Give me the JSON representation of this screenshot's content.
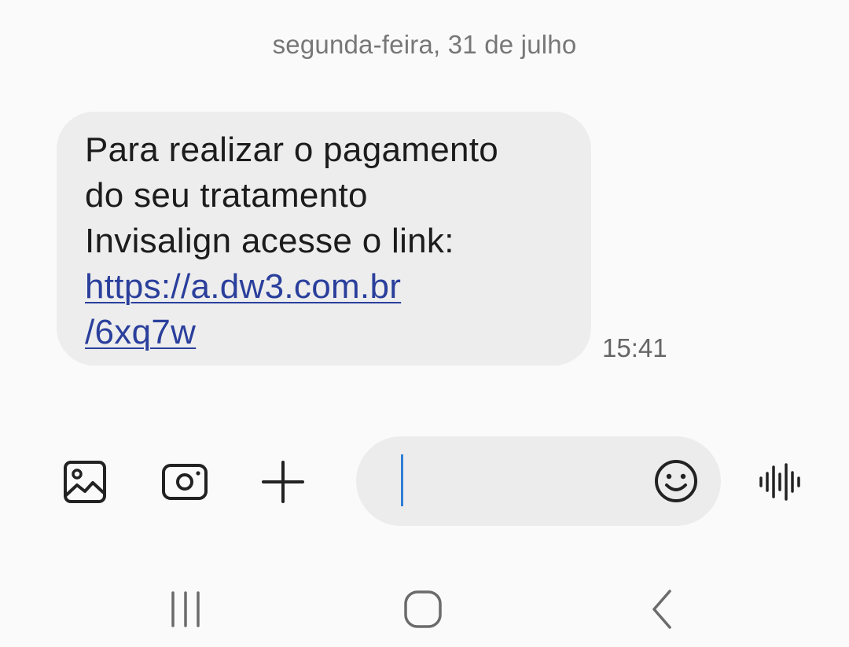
{
  "conversation": {
    "date_header": "segunda-feira, 31 de julho"
  },
  "message": {
    "text_lines": [
      "Para realizar o pagamento",
      "do seu tratamento",
      "Invisalign acesse o link:"
    ],
    "link_lines": [
      "https://a.dw3.com.br",
      "/6xq7w"
    ],
    "time": "15:41"
  },
  "composer": {
    "input_value": "",
    "icons": {
      "gallery": "gallery-icon",
      "camera": "camera-icon",
      "add": "plus-icon",
      "emoji": "emoji-icon",
      "voice": "voice-waveform-icon"
    }
  },
  "navigation": {
    "icons": {
      "recents": "recent-apps-icon",
      "home": "home-icon",
      "back": "back-icon"
    }
  },
  "colors": {
    "background": "#fafafa",
    "bubble": "#ededed",
    "link": "#2a3f9c",
    "caret": "#2f7fd6",
    "icon": "#222222",
    "nav_icon": "#6b6b6b"
  }
}
